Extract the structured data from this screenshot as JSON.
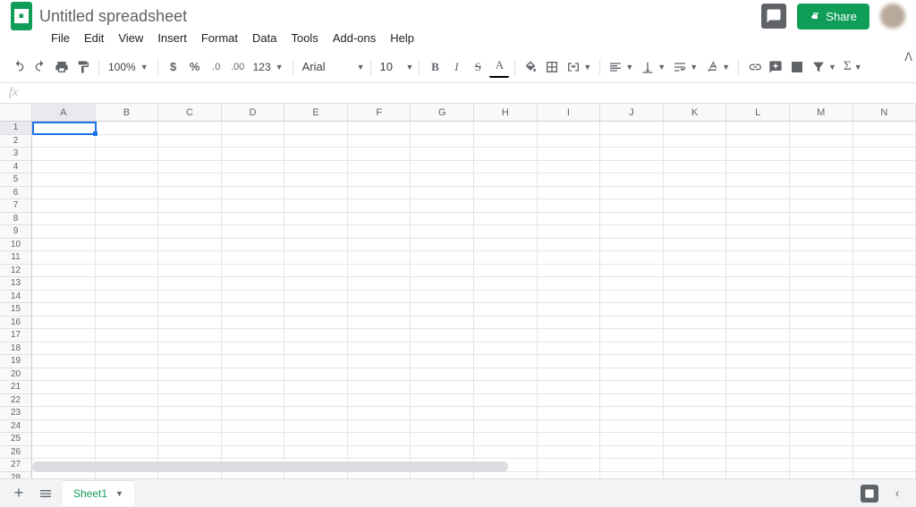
{
  "header": {
    "title": "Untitled spreadsheet",
    "share_label": "Share"
  },
  "menu": {
    "items": [
      "File",
      "Edit",
      "View",
      "Insert",
      "Format",
      "Data",
      "Tools",
      "Add-ons",
      "Help"
    ]
  },
  "toolbar": {
    "zoom": "100%",
    "font": "Arial",
    "font_size": "10",
    "more_formats": "123"
  },
  "columns": [
    "A",
    "B",
    "C",
    "D",
    "E",
    "F",
    "G",
    "H",
    "I",
    "J",
    "K",
    "L",
    "M",
    "N"
  ],
  "rows": [
    1,
    2,
    3,
    4,
    5,
    6,
    7,
    8,
    9,
    10,
    11,
    12,
    13,
    14,
    15,
    16,
    17,
    18,
    19,
    20,
    21,
    22,
    23,
    24,
    25,
    26,
    27,
    28
  ],
  "selected_cell": {
    "row": 1,
    "col": "A"
  },
  "footer": {
    "sheet_name": "Sheet1"
  }
}
